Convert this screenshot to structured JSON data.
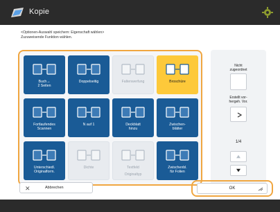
{
  "app": {
    "title": "Kopie"
  },
  "instruction": {
    "line1": "<Optionen-Auswahl speichern: Eigenschaft wählen>",
    "line2": "Zuzuweisende Funktion wählen."
  },
  "tiles": [
    {
      "label": "Buch→\n2 Seiten",
      "icon": "book-to-pages-icon",
      "state": "normal"
    },
    {
      "label": "Doppelseitig",
      "icon": "two-sided-icon",
      "state": "normal"
    },
    {
      "label": "Faltenwerfung",
      "icon": "fold-icon",
      "state": "disabled"
    },
    {
      "label": "Broschüre",
      "icon": "booklet-icon",
      "state": "selected"
    },
    {
      "label": "Fortlaufendes\nScannen",
      "icon": "continuous-scan-icon",
      "state": "normal"
    },
    {
      "label": "N auf 1",
      "icon": "n-on-1-icon",
      "state": "normal"
    },
    {
      "label": "Deckblatt\nhinzu",
      "icon": "cover-sheet-icon",
      "state": "normal"
    },
    {
      "label": "Zwischen-\nblätter",
      "icon": "insert-sheets-icon",
      "state": "normal"
    },
    {
      "label": "Unterschiedl.\nOriginalform.",
      "icon": "different-originals-icon",
      "state": "normal"
    },
    {
      "label": "Dichte",
      "icon": "density-icon",
      "state": "disabled"
    },
    {
      "label": "Textfeld",
      "icon": "text-field-icon",
      "state": "disabled"
    },
    {
      "label": "Originaltyp",
      "icon": "original-type-icon",
      "state": "disabled"
    },
    {
      "label": "Zwischenbl.\nfür Folien",
      "icon": "transparency-interleaf-icon",
      "state": "normal"
    }
  ],
  "side": {
    "unassigned_label": "Nicht\nzugeordnet",
    "save_label": "Erstellt vor-\nhergeh. Vor.",
    "page_counter": "1/4"
  },
  "buttons": {
    "cancel": "Abbrechen",
    "ok": "OK"
  },
  "colors": {
    "selected": "#fdc93a",
    "tile": "#1a5b96",
    "highlight": "#f0a640"
  }
}
